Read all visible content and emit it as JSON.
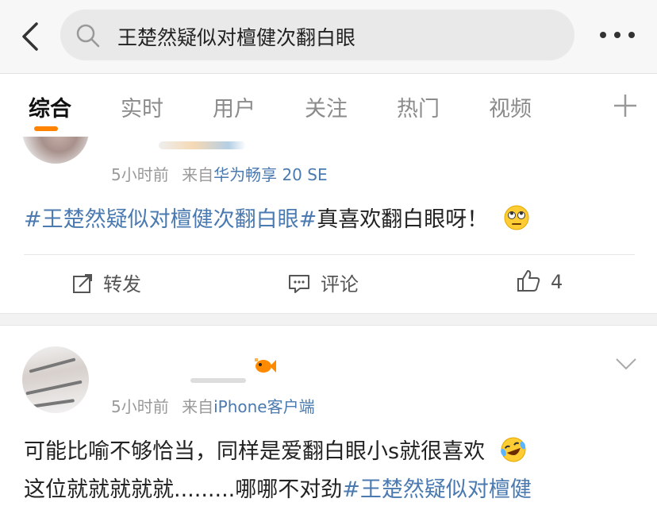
{
  "search": {
    "query": "王楚然疑似对檀健次翻白眼"
  },
  "tabs": [
    {
      "label": "综合",
      "active": true
    },
    {
      "label": "实时"
    },
    {
      "label": "用户"
    },
    {
      "label": "关注"
    },
    {
      "label": "热门"
    },
    {
      "label": "视频"
    }
  ],
  "colors": {
    "accent": "#ff8200",
    "link": "#4a7ab0"
  },
  "posts": [
    {
      "time": "5小时前",
      "from_label": "来自",
      "source": "华为畅享 20 SE",
      "hashtag": "#王楚然疑似对檀健次翻白眼#",
      "text": "真喜欢翻白眼呀！",
      "emoji": "eye-roll-emoji",
      "repost_label": "转发",
      "comment_label": "评论",
      "like_count": "4"
    },
    {
      "time": "5小时前",
      "from_label": "来自",
      "source": "iPhone客户端",
      "line1": "可能比喻不够恰当，同样是爱翻白眼小s就很喜欢",
      "line2": "这位就就就就就.........哪哪不对劲",
      "hashtag": "#王楚然疑似对檀健",
      "emoji": "laugh-cry-emoji"
    }
  ]
}
